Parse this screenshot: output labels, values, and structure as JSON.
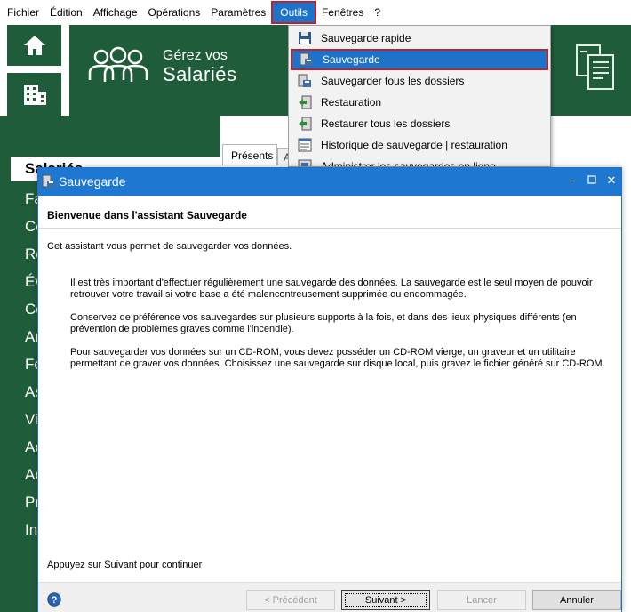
{
  "menubar": {
    "items": [
      "Fichier",
      "Édition",
      "Affichage",
      "Opérations",
      "Paramètres",
      "Outils",
      "Fenêtres",
      "?"
    ],
    "active_index": 5
  },
  "banner": {
    "line1": "Gérez vos",
    "line2": "Salariés"
  },
  "sidebar": {
    "active_label": "Salariés",
    "items": [
      "Fa",
      "Co",
      "Re",
      "Év",
      "Co",
      "Ar",
      "Fo",
      "As",
      "Vi",
      "Ac",
      "Ac",
      "Pr",
      "In"
    ]
  },
  "tabs": {
    "presents": "Présents",
    "stub": "A"
  },
  "dropdown": {
    "items": [
      {
        "label": "Sauvegarde rapide",
        "icon": "floppy-icon"
      },
      {
        "label": "Sauvegarde",
        "icon": "backup-icon"
      },
      {
        "label": "Sauvegarder tous les dossiers",
        "icon": "backup-all-icon"
      },
      {
        "label": "Restauration",
        "icon": "restore-icon"
      },
      {
        "label": "Restaurer tous les dossiers",
        "icon": "restore-all-icon"
      },
      {
        "label": "Historique de sauvegarde | restauration",
        "icon": "history-icon"
      },
      {
        "label": "Administrer les sauvegardes en ligne",
        "icon": "online-backup-icon"
      }
    ],
    "selected_index": 1
  },
  "dialog": {
    "title": "Sauvegarde",
    "heading": "Bienvenue dans l'assistant Sauvegarde",
    "intro": "Cet assistant vous permet de sauvegarder vos données.",
    "para1": "Il est très important d'effectuer régulièrement une sauvegarde des données. La sauvegarde est le seul moyen de pouvoir retrouver votre travail si votre base a été malencontreusement supprimée ou endommagée.",
    "para2": "Conservez de préférence vos sauvegardes sur plusieurs supports à la fois, et dans des lieux physiques différents (en prévention de problèmes graves comme l'incendie).",
    "para3": "Pour sauvegarder vos données sur un CD-ROM, vous devez posséder un CD-ROM vierge, un graveur et un utilitaire permettant de graver vos données. Choisissez une sauvegarde sur disque local, puis gravez le fichier généré sur CD-ROM.",
    "continue_hint": "Appuyez sur Suivant pour continuer",
    "buttons": {
      "previous": "< Précédent",
      "next": "Suivant >",
      "cancel": "Lancer",
      "close": "Annuler"
    }
  },
  "colors": {
    "green": "#1f5c3a",
    "accent_blue": "#1e72c8",
    "highlight_red": "#c0202a"
  }
}
